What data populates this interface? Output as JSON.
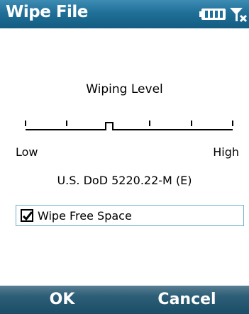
{
  "window": {
    "title": "Wipe File",
    "status_icons": [
      "battery-icon",
      "signal-icon"
    ]
  },
  "wiping": {
    "heading": "Wiping Level",
    "low_label": "Low",
    "high_label": "High",
    "level_index": 2,
    "level_count": 6,
    "standard_label": "U.S. DoD 5220.22-M (E)"
  },
  "options": {
    "wipe_free_space_label": "Wipe Free Space",
    "wipe_free_space_checked": true
  },
  "softkeys": {
    "left": "OK",
    "right": "Cancel"
  },
  "colors": {
    "titlebar": "#1f6f98",
    "softkeybar": "#2e5f78",
    "focus_border": "#6fb0d0"
  }
}
